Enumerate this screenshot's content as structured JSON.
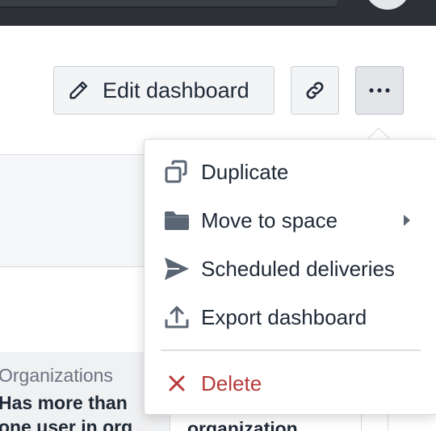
{
  "toolbar": {
    "edit_label": "Edit dashboard"
  },
  "icons": {
    "edit": "pencil-icon",
    "link": "link-icon",
    "more": "ellipsis-icon",
    "duplicate": "copy-icon",
    "move": "folder-icon",
    "scheduled": "send-icon",
    "export": "upload-icon",
    "delete": "x-icon",
    "submenu": "caret-right-icon"
  },
  "menu": {
    "items": [
      {
        "label": "Duplicate"
      },
      {
        "label": "Move to space"
      },
      {
        "label": "Scheduled deliveries"
      },
      {
        "label": "Export dashboard"
      }
    ],
    "delete_label": "Delete"
  },
  "background": {
    "table_header": "Organizations",
    "row_text_1": "Has more than",
    "row_text_2": "one user in org",
    "cell_text": "organization"
  },
  "colors": {
    "topbar": "#2d3036",
    "icon_gray": "#5a6673",
    "delete_red": "#b73a3a",
    "button_bg": "#f3f4f6"
  }
}
